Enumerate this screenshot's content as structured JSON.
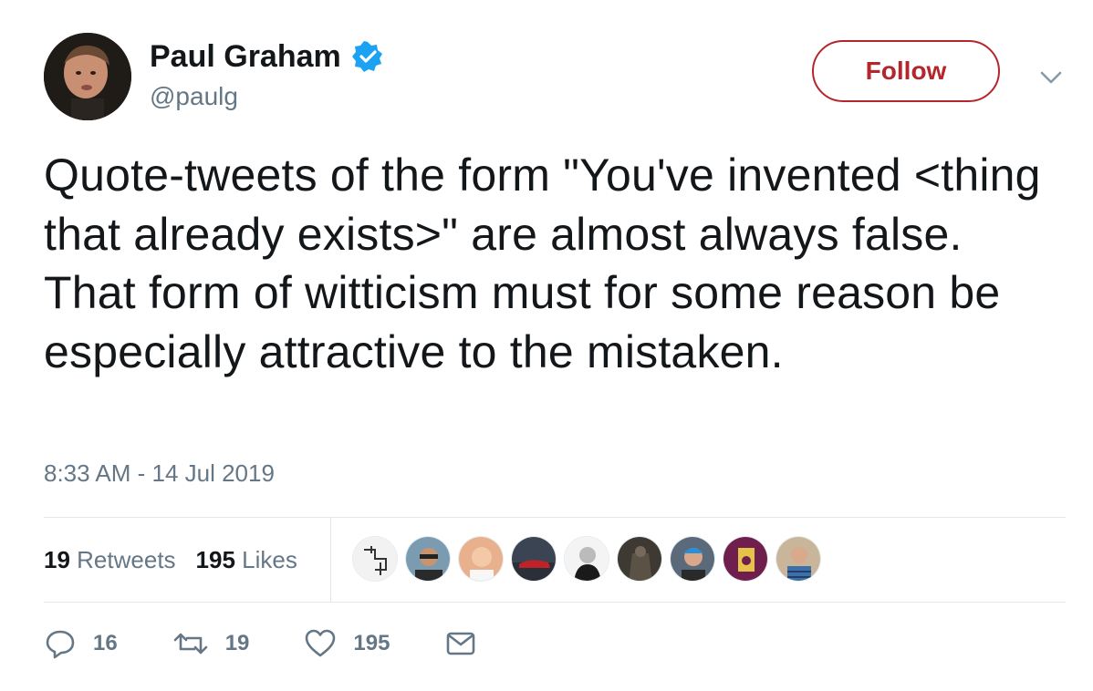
{
  "author": {
    "name": "Paul Graham",
    "handle": "@paulg",
    "verified": true
  },
  "header": {
    "follow_label": "Follow",
    "menu_icon": "chevron-down-icon"
  },
  "tweet": {
    "text": "Quote-tweets of the form \"You've invented <thing that already exists>\" are almost always false. That form of witticism must for some reason be especially attractive to the mistaken.",
    "timestamp": "8:33 AM - 14 Jul 2019"
  },
  "stats": {
    "retweets_count": "19",
    "retweets_label": "Retweets",
    "likes_count": "195",
    "likes_label": "Likes"
  },
  "actions": {
    "reply_count": "16",
    "retweet_count": "19",
    "like_count": "195"
  },
  "colors": {
    "follow": "#b5262c",
    "verified": "#1da1f2",
    "muted": "#657786"
  }
}
